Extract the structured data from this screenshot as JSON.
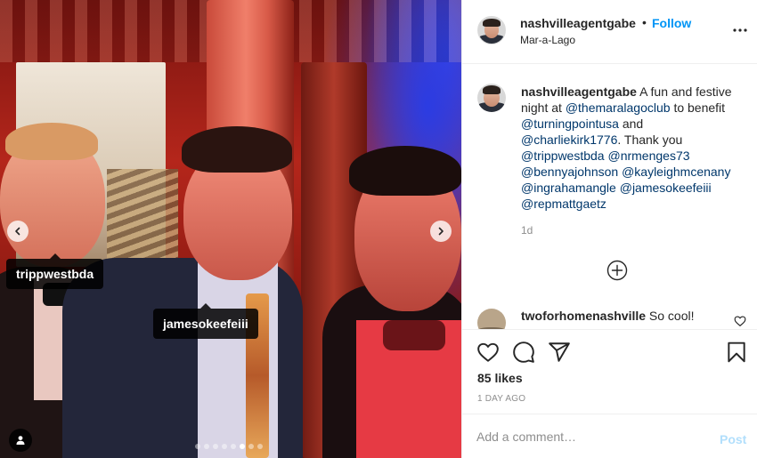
{
  "post": {
    "username": "nashvilleagentgabe",
    "separator": "•",
    "follow_label": "Follow",
    "location": "Mar-a-Lago",
    "more_icon": "more-horizontal-icon"
  },
  "photo": {
    "tags": [
      "trippwestbda",
      "jamesokeefeiii"
    ],
    "carousel": {
      "total": 8,
      "active_index": 6
    }
  },
  "caption": {
    "username": "nashvilleagentgabe",
    "segments": [
      {
        "type": "text",
        "value": " A fun and festive night at "
      },
      {
        "type": "mention",
        "value": "@themaralagoclub"
      },
      {
        "type": "text",
        "value": " to benefit "
      },
      {
        "type": "mention",
        "value": "@turningpointusa"
      },
      {
        "type": "text",
        "value": " and "
      },
      {
        "type": "mention",
        "value": "@charliekirk1776"
      },
      {
        "type": "text",
        "value": ". Thank you "
      },
      {
        "type": "mention",
        "value": "@trippwestbda"
      },
      {
        "type": "text",
        "value": " "
      },
      {
        "type": "mention",
        "value": "@nrmenges73"
      },
      {
        "type": "text",
        "value": " "
      },
      {
        "type": "mention",
        "value": "@bennyajohnson"
      },
      {
        "type": "text",
        "value": " "
      },
      {
        "type": "mention",
        "value": "@kayleighmcenany"
      },
      {
        "type": "text",
        "value": " "
      },
      {
        "type": "mention",
        "value": "@ingrahamangle"
      },
      {
        "type": "text",
        "value": " "
      },
      {
        "type": "mention",
        "value": "@jamesokeefeiii"
      },
      {
        "type": "text",
        "value": " "
      },
      {
        "type": "mention",
        "value": "@repmattgaetz"
      }
    ],
    "time": "1d"
  },
  "comments": [
    {
      "username": "twoforhomenashville",
      "text": " So cool!"
    }
  ],
  "stats": {
    "likes": "85 likes",
    "date": "1 DAY AGO"
  },
  "comment_box": {
    "placeholder": "Add a comment…",
    "post_label": "Post"
  },
  "colors": {
    "link": "#00376b",
    "follow": "#0095f6",
    "post_disabled": "#b2dffc",
    "muted": "#8e8e8e"
  }
}
